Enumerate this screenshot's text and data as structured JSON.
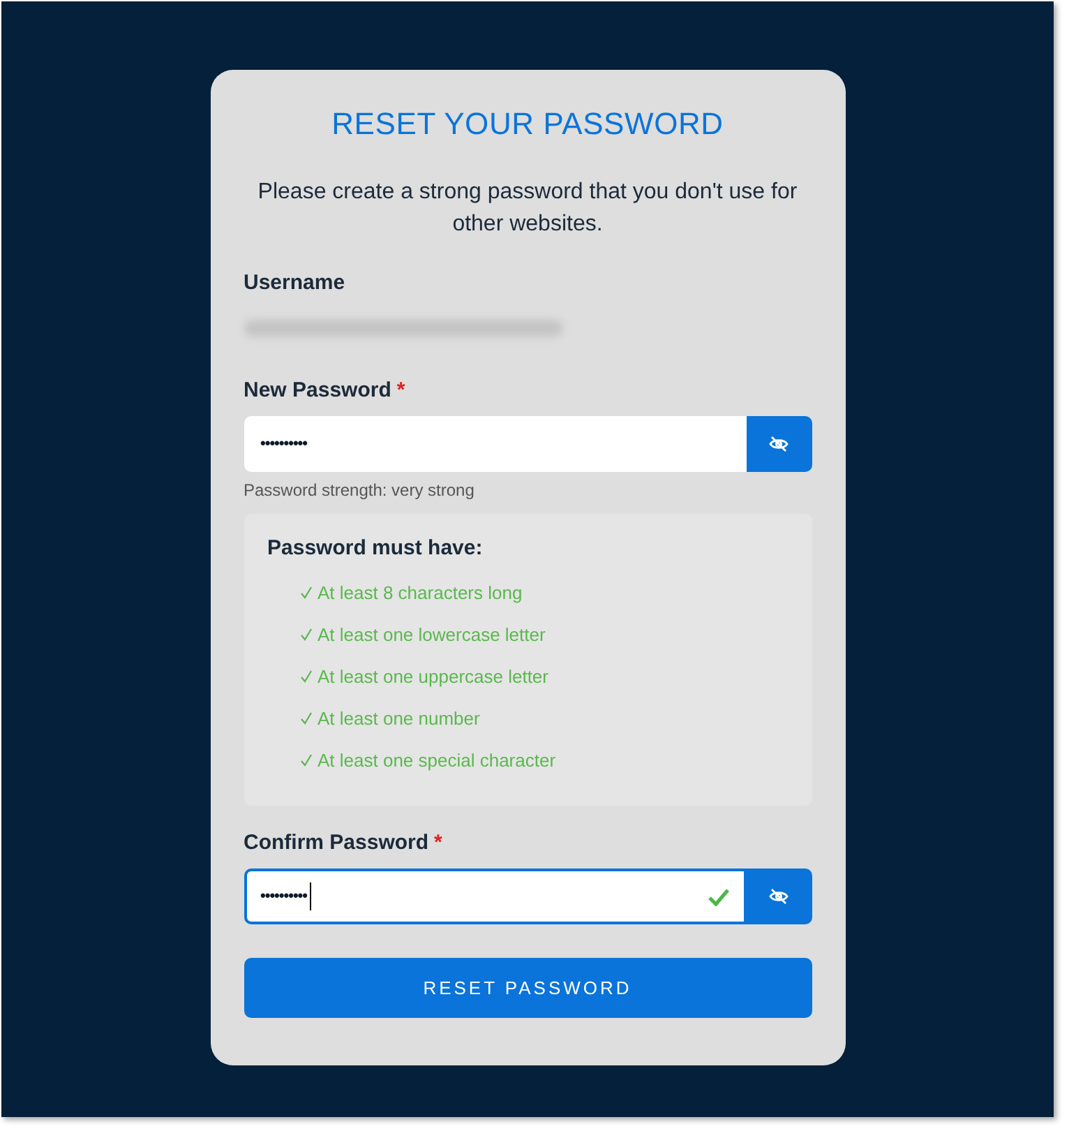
{
  "title": "RESET YOUR PASSWORD",
  "intro": "Please create a strong password that you don't use for other websites.",
  "username": {
    "label": "Username",
    "redacted": true
  },
  "new_password": {
    "label": "New Password",
    "required_mark": "*",
    "value": "••••••••••",
    "focused": false,
    "strength": "Password strength: very strong"
  },
  "requirements": {
    "title": "Password must have:",
    "items": [
      {
        "text": "At least 8 characters long",
        "met": true
      },
      {
        "text": "At least one lowercase letter",
        "met": true
      },
      {
        "text": "At least one uppercase letter",
        "met": true
      },
      {
        "text": "At least one number",
        "met": true
      },
      {
        "text": "At least one special character",
        "met": true
      }
    ]
  },
  "confirm_password": {
    "label": "Confirm Password",
    "required_mark": "*",
    "value": "••••••••••",
    "focused": true,
    "valid": true
  },
  "submit": "RESET PASSWORD"
}
